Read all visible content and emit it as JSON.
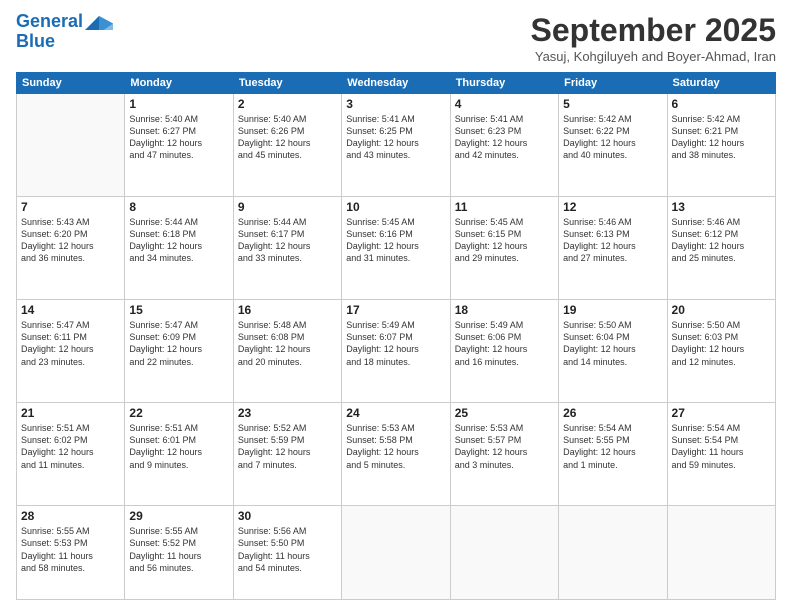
{
  "header": {
    "logo_line1": "General",
    "logo_line2": "Blue",
    "month": "September 2025",
    "location": "Yasuj, Kohgiluyeh and Boyer-Ahmad, Iran"
  },
  "weekdays": [
    "Sunday",
    "Monday",
    "Tuesday",
    "Wednesday",
    "Thursday",
    "Friday",
    "Saturday"
  ],
  "weeks": [
    [
      {
        "day": "",
        "text": ""
      },
      {
        "day": "1",
        "text": "Sunrise: 5:40 AM\nSunset: 6:27 PM\nDaylight: 12 hours\nand 47 minutes."
      },
      {
        "day": "2",
        "text": "Sunrise: 5:40 AM\nSunset: 6:26 PM\nDaylight: 12 hours\nand 45 minutes."
      },
      {
        "day": "3",
        "text": "Sunrise: 5:41 AM\nSunset: 6:25 PM\nDaylight: 12 hours\nand 43 minutes."
      },
      {
        "day": "4",
        "text": "Sunrise: 5:41 AM\nSunset: 6:23 PM\nDaylight: 12 hours\nand 42 minutes."
      },
      {
        "day": "5",
        "text": "Sunrise: 5:42 AM\nSunset: 6:22 PM\nDaylight: 12 hours\nand 40 minutes."
      },
      {
        "day": "6",
        "text": "Sunrise: 5:42 AM\nSunset: 6:21 PM\nDaylight: 12 hours\nand 38 minutes."
      }
    ],
    [
      {
        "day": "7",
        "text": "Sunrise: 5:43 AM\nSunset: 6:20 PM\nDaylight: 12 hours\nand 36 minutes."
      },
      {
        "day": "8",
        "text": "Sunrise: 5:44 AM\nSunset: 6:18 PM\nDaylight: 12 hours\nand 34 minutes."
      },
      {
        "day": "9",
        "text": "Sunrise: 5:44 AM\nSunset: 6:17 PM\nDaylight: 12 hours\nand 33 minutes."
      },
      {
        "day": "10",
        "text": "Sunrise: 5:45 AM\nSunset: 6:16 PM\nDaylight: 12 hours\nand 31 minutes."
      },
      {
        "day": "11",
        "text": "Sunrise: 5:45 AM\nSunset: 6:15 PM\nDaylight: 12 hours\nand 29 minutes."
      },
      {
        "day": "12",
        "text": "Sunrise: 5:46 AM\nSunset: 6:13 PM\nDaylight: 12 hours\nand 27 minutes."
      },
      {
        "day": "13",
        "text": "Sunrise: 5:46 AM\nSunset: 6:12 PM\nDaylight: 12 hours\nand 25 minutes."
      }
    ],
    [
      {
        "day": "14",
        "text": "Sunrise: 5:47 AM\nSunset: 6:11 PM\nDaylight: 12 hours\nand 23 minutes."
      },
      {
        "day": "15",
        "text": "Sunrise: 5:47 AM\nSunset: 6:09 PM\nDaylight: 12 hours\nand 22 minutes."
      },
      {
        "day": "16",
        "text": "Sunrise: 5:48 AM\nSunset: 6:08 PM\nDaylight: 12 hours\nand 20 minutes."
      },
      {
        "day": "17",
        "text": "Sunrise: 5:49 AM\nSunset: 6:07 PM\nDaylight: 12 hours\nand 18 minutes."
      },
      {
        "day": "18",
        "text": "Sunrise: 5:49 AM\nSunset: 6:06 PM\nDaylight: 12 hours\nand 16 minutes."
      },
      {
        "day": "19",
        "text": "Sunrise: 5:50 AM\nSunset: 6:04 PM\nDaylight: 12 hours\nand 14 minutes."
      },
      {
        "day": "20",
        "text": "Sunrise: 5:50 AM\nSunset: 6:03 PM\nDaylight: 12 hours\nand 12 minutes."
      }
    ],
    [
      {
        "day": "21",
        "text": "Sunrise: 5:51 AM\nSunset: 6:02 PM\nDaylight: 12 hours\nand 11 minutes."
      },
      {
        "day": "22",
        "text": "Sunrise: 5:51 AM\nSunset: 6:01 PM\nDaylight: 12 hours\nand 9 minutes."
      },
      {
        "day": "23",
        "text": "Sunrise: 5:52 AM\nSunset: 5:59 PM\nDaylight: 12 hours\nand 7 minutes."
      },
      {
        "day": "24",
        "text": "Sunrise: 5:53 AM\nSunset: 5:58 PM\nDaylight: 12 hours\nand 5 minutes."
      },
      {
        "day": "25",
        "text": "Sunrise: 5:53 AM\nSunset: 5:57 PM\nDaylight: 12 hours\nand 3 minutes."
      },
      {
        "day": "26",
        "text": "Sunrise: 5:54 AM\nSunset: 5:55 PM\nDaylight: 12 hours\nand 1 minute."
      },
      {
        "day": "27",
        "text": "Sunrise: 5:54 AM\nSunset: 5:54 PM\nDaylight: 11 hours\nand 59 minutes."
      }
    ],
    [
      {
        "day": "28",
        "text": "Sunrise: 5:55 AM\nSunset: 5:53 PM\nDaylight: 11 hours\nand 58 minutes."
      },
      {
        "day": "29",
        "text": "Sunrise: 5:55 AM\nSunset: 5:52 PM\nDaylight: 11 hours\nand 56 minutes."
      },
      {
        "day": "30",
        "text": "Sunrise: 5:56 AM\nSunset: 5:50 PM\nDaylight: 11 hours\nand 54 minutes."
      },
      {
        "day": "",
        "text": ""
      },
      {
        "day": "",
        "text": ""
      },
      {
        "day": "",
        "text": ""
      },
      {
        "day": "",
        "text": ""
      }
    ]
  ]
}
